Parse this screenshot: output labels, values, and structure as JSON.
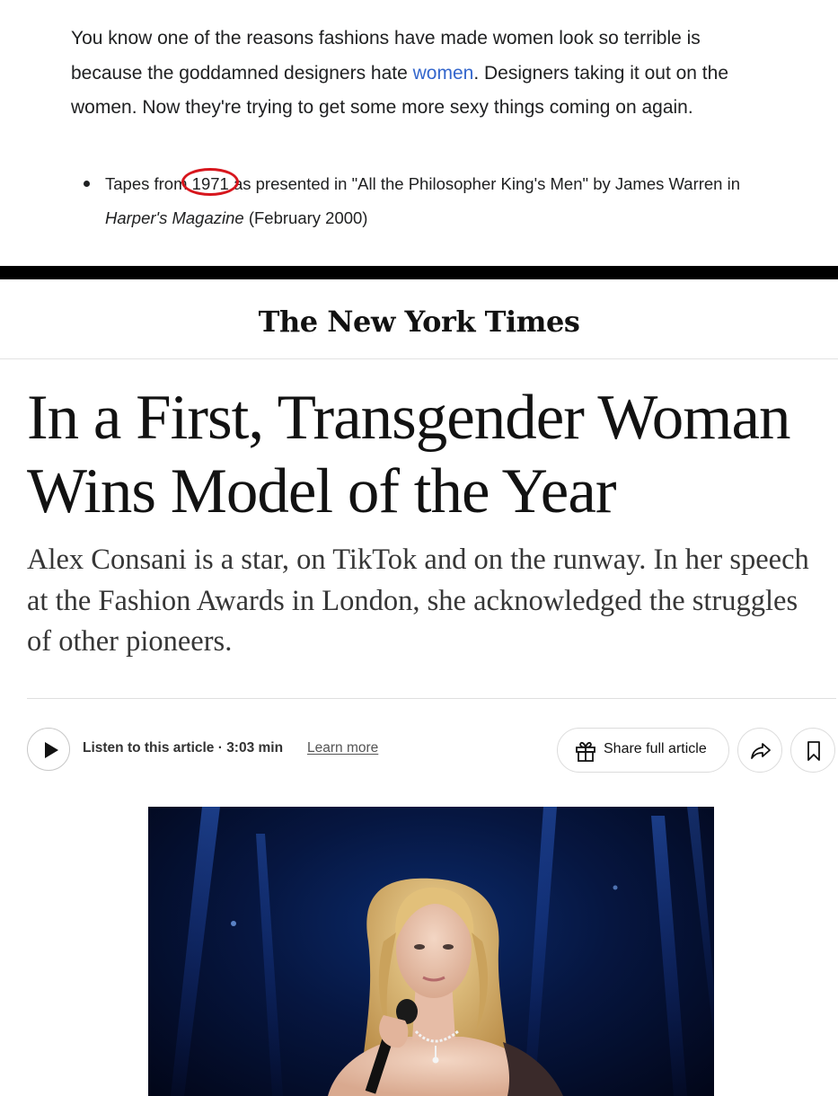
{
  "quote": {
    "text_before_link": "You know one of the reasons fashions have made women look so terrible is because the goddamned designers hate ",
    "link_text": "women",
    "text_after_link": ". Designers taking it out on the women. Now they're trying to get some more sexy things coming on again."
  },
  "source": {
    "prefix": "Tapes from ",
    "circled_year": "1971",
    "middle": " as presented in \"All the Philosopher King's Men\" by James Warren in ",
    "publication": "Harper's Magazine",
    "suffix": " (February 2000)"
  },
  "nyt": {
    "masthead": "The New York Times",
    "headline": "In a First, Transgender Woman Wins Model of the Year",
    "summary": "Alex Consani is a star, on TikTok and on the runway. In her speech at the Fashion Awards in London, she acknowledged the struggles of other pioneers.",
    "listen_label": "Listen to this article · 3:03 min",
    "learn_more": "Learn more",
    "share_label": "Share full article"
  },
  "icons": {
    "play": "play-icon",
    "gift": "gift-icon",
    "share": "share-arrow-icon",
    "bookmark": "bookmark-icon"
  },
  "colors": {
    "link": "#3366cc",
    "circle": "#d7161d",
    "divider": "#000000"
  }
}
